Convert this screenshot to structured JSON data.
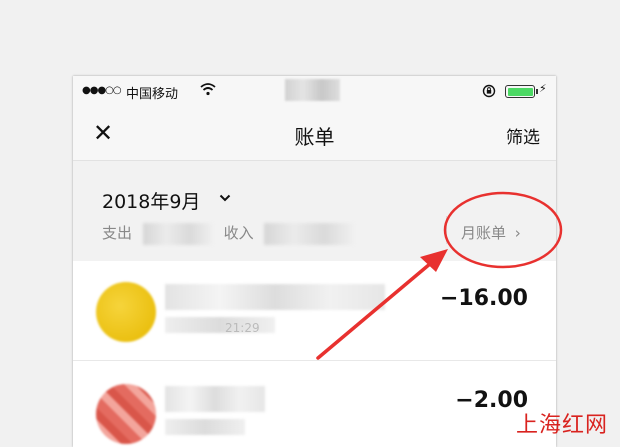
{
  "status_bar": {
    "signal": "●●●○○",
    "carrier": "中国移动",
    "colors": {
      "battery": "#4cd964"
    }
  },
  "nav": {
    "close_icon": "✕",
    "title": "账单",
    "filter_label": "筛选"
  },
  "month_header": {
    "date": "2018年9月",
    "expense_label": "支出",
    "income_label": "收入",
    "monthly_bill_label": "月账单",
    "monthly_bill_arrow": "›"
  },
  "records": [
    {
      "amount": "−16.00",
      "time_fragment": "21:29",
      "avatar_color": "#f2c417"
    },
    {
      "amount": "−2.00",
      "avatar_color": "#e0655a"
    }
  ],
  "annotation": {
    "color": "#e8312f"
  },
  "watermark": "上海红网"
}
